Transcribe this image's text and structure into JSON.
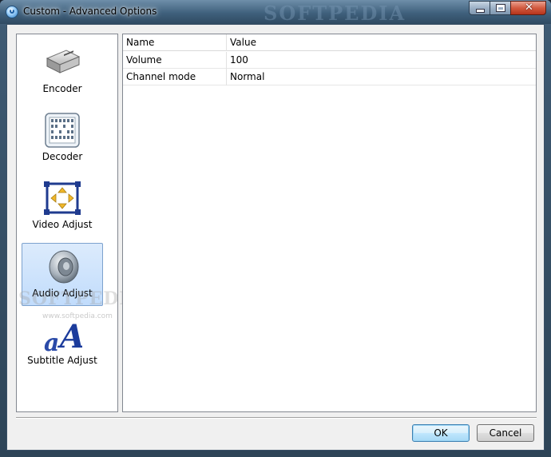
{
  "window": {
    "title": "Custom - Advanced Options",
    "watermark": "SOFTPEDIA",
    "controls": {
      "minimize": "minimize-icon",
      "maximize": "maximize-icon",
      "close": "close-icon"
    }
  },
  "sidebar": {
    "items": [
      {
        "label": "Encoder",
        "icon": "encoder-drive-icon",
        "selected": false
      },
      {
        "label": "Decoder",
        "icon": "decoder-film-icon",
        "selected": false
      },
      {
        "label": "Video Adjust",
        "icon": "video-adjust-frame-icon",
        "selected": false
      },
      {
        "label": "Audio Adjust",
        "icon": "speaker-icon",
        "selected": true
      },
      {
        "label": "Subtitle Adjust",
        "icon": "subtitle-text-icon",
        "selected": false
      }
    ],
    "watermark": "SOFTPEDIA",
    "watermark_url": "www.softpedia.com"
  },
  "grid": {
    "columns": [
      "Name",
      "Value"
    ],
    "rows": [
      {
        "name": "Volume",
        "value": "100"
      },
      {
        "name": "Channel mode",
        "value": "Normal"
      }
    ]
  },
  "buttons": {
    "ok": "OK",
    "cancel": "Cancel"
  },
  "colors": {
    "selection": "#c1dcfc",
    "selection_border": "#7da2ce",
    "titlebar": "#3f607c"
  }
}
